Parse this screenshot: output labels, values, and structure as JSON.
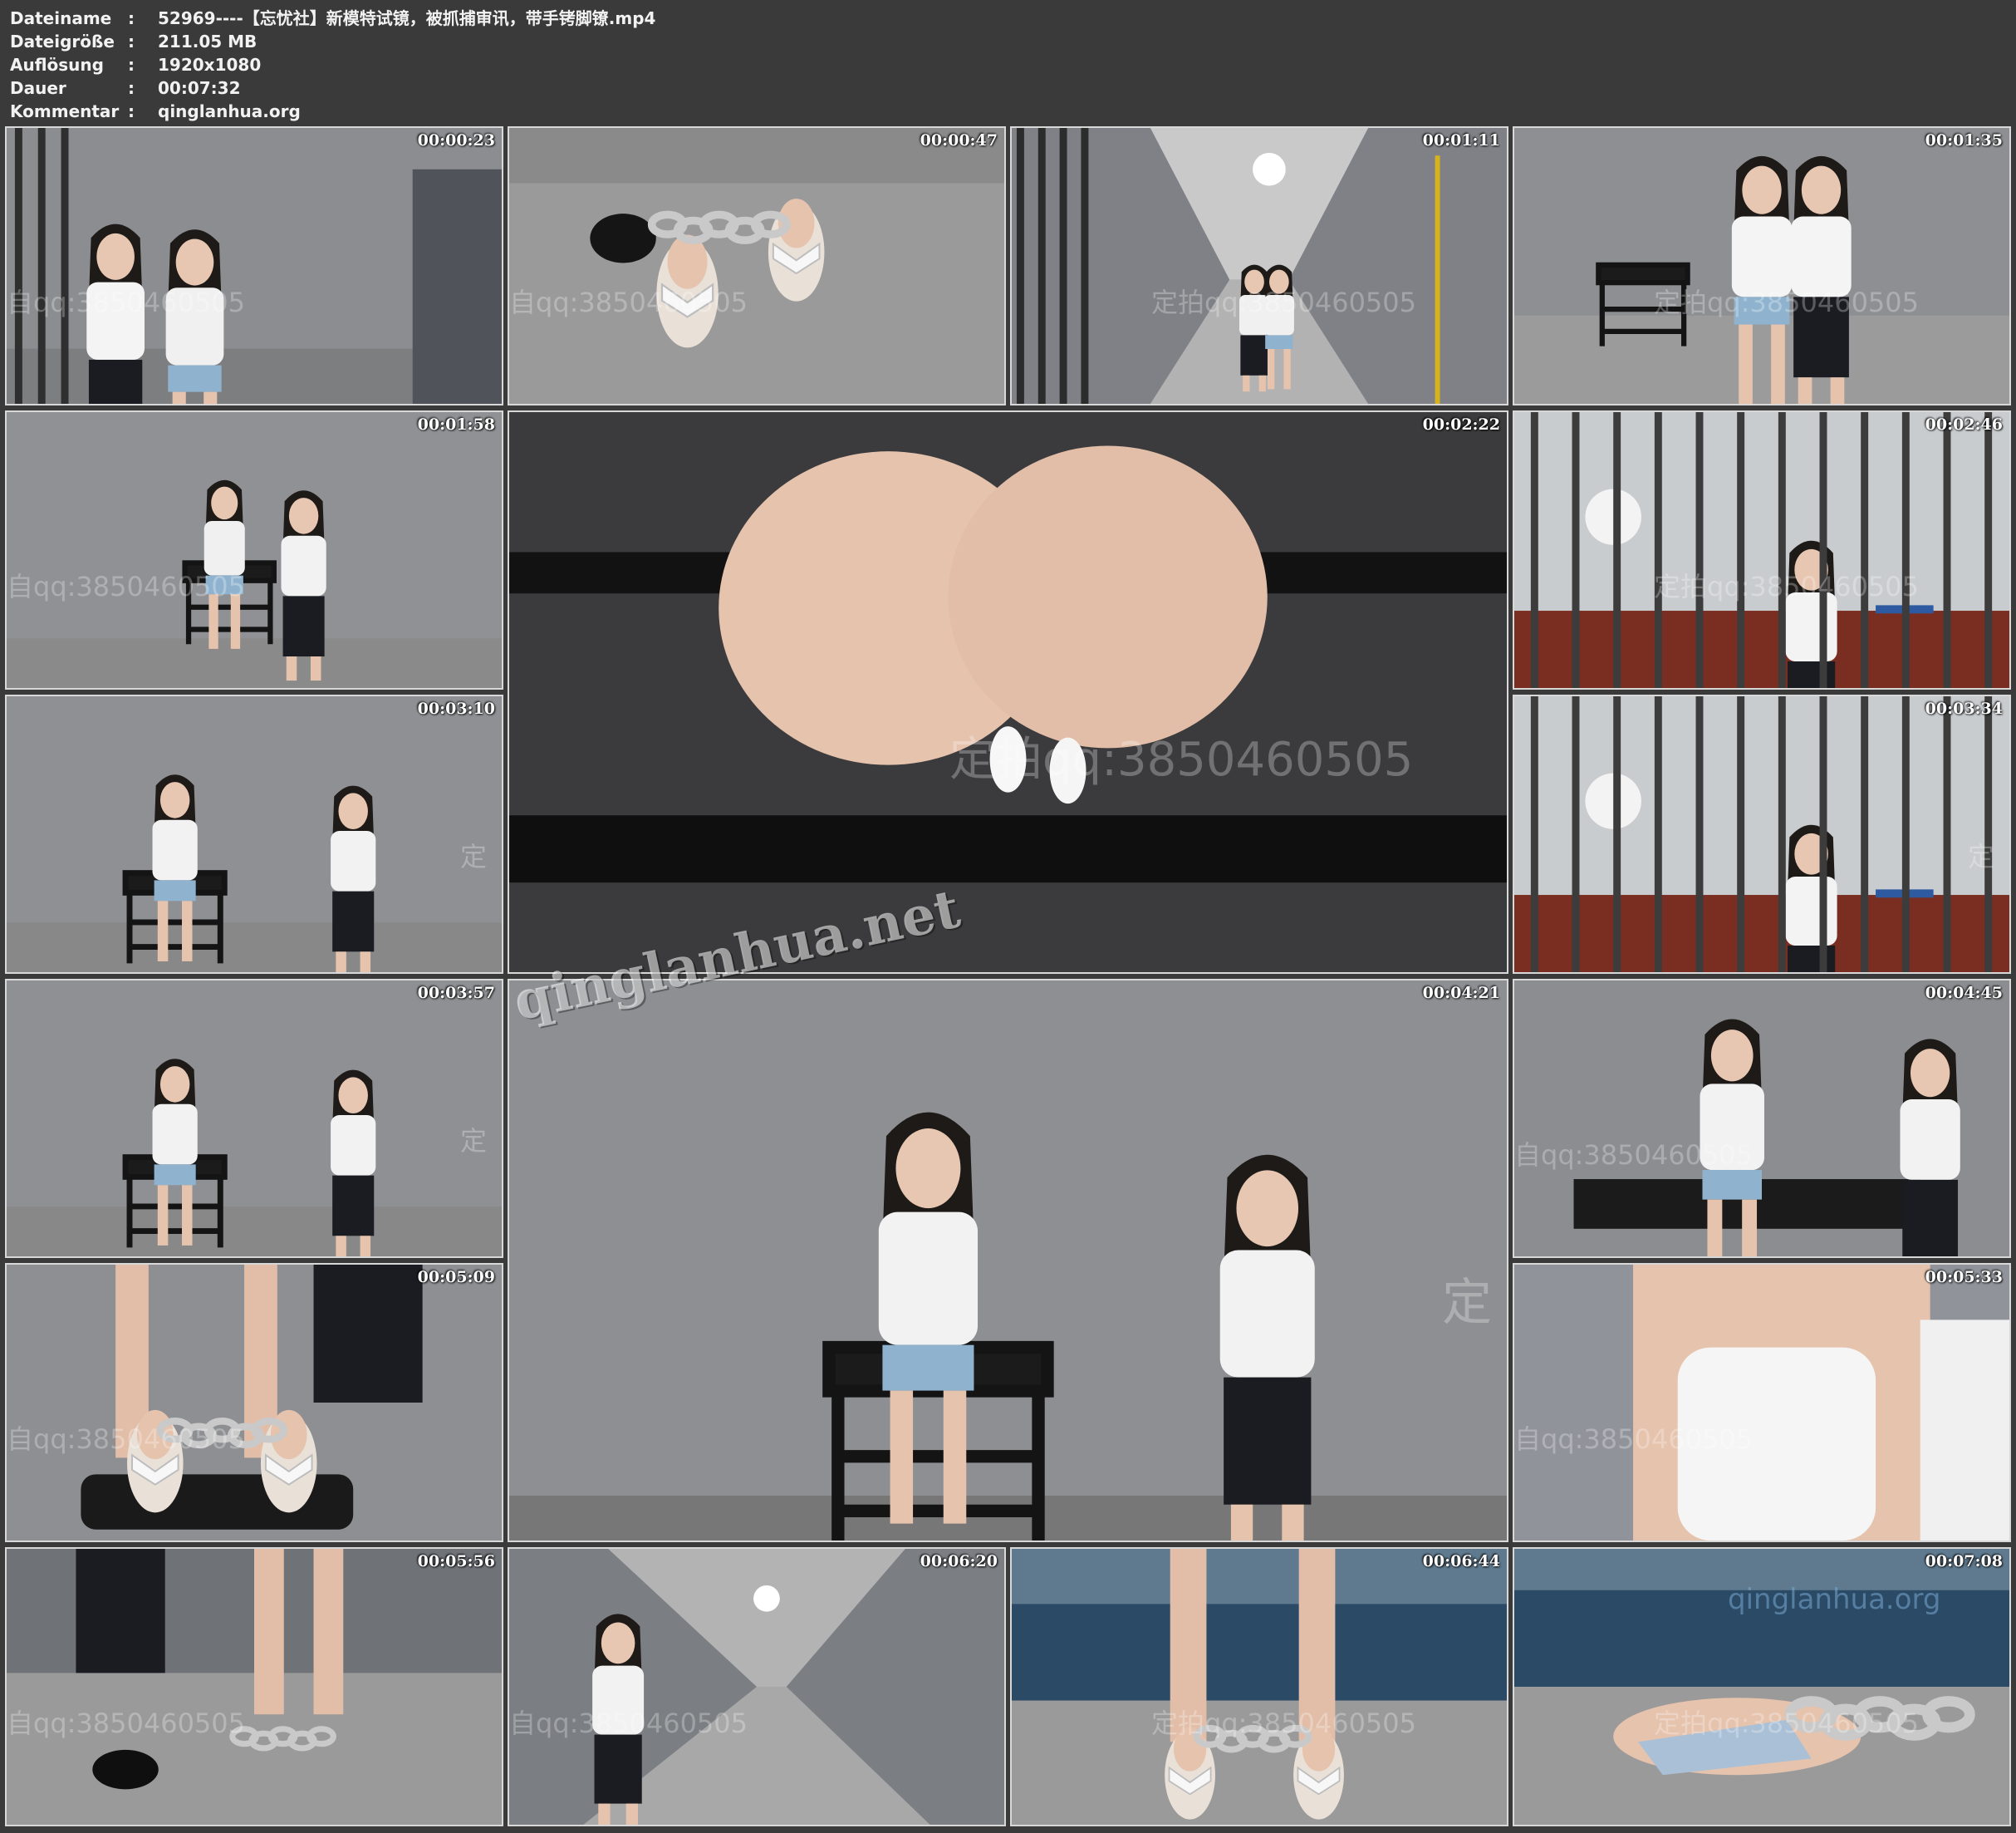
{
  "metadata": [
    {
      "label": "Dateiname",
      "value": "52969----【忘忧社】新模特试镜，被抓捕审讯，带手铐脚镣.mp4"
    },
    {
      "label": "Dateigröße",
      "value": "211.05 MB"
    },
    {
      "label": "Auflösung",
      "value": "1920x1080"
    },
    {
      "label": "Dauer",
      "value": "00:07:32"
    },
    {
      "label": "Kommentar",
      "value": "qinglanhua.org"
    }
  ],
  "separator": ":",
  "thumbnails": [
    {
      "timestamp": "00:00:23",
      "scene": "cell-door",
      "watermark": "自qq:3850460505"
    },
    {
      "timestamp": "00:00:47",
      "scene": "feet-chains",
      "watermark": "自qq:3850460505"
    },
    {
      "timestamp": "00:01:11",
      "scene": "corridor",
      "watermark": "定拍qq:3850460505"
    },
    {
      "timestamp": "00:01:35",
      "scene": "chair-room",
      "watermark": "定拍qq:3850460505"
    },
    {
      "timestamp": "00:01:58",
      "scene": "restraint-chair",
      "watermark": "自qq:3850460505"
    },
    {
      "timestamp": "00:02:22",
      "scene": "hands-closeup",
      "watermark": "定拍qq:3850460505"
    },
    {
      "timestamp": "00:02:46",
      "scene": "officer-desk",
      "watermark": "定拍qq:3850460505"
    },
    {
      "timestamp": "00:03:10",
      "scene": "seated-pair",
      "watermark": "定"
    },
    {
      "timestamp": "00:03:34",
      "scene": "officer-desk",
      "watermark": "定"
    },
    {
      "timestamp": "00:03:57",
      "scene": "seated-pair",
      "watermark": "定"
    },
    {
      "timestamp": "00:04:21",
      "scene": "seated-pair-large",
      "watermark": "定"
    },
    {
      "timestamp": "00:04:45",
      "scene": "seated-pair-close",
      "watermark": "自qq:3850460505"
    },
    {
      "timestamp": "00:05:09",
      "scene": "feet-chains-chair",
      "watermark": "自qq:3850460505"
    },
    {
      "timestamp": "00:05:33",
      "scene": "torso-closeup",
      "watermark": "自qq:3850460505"
    },
    {
      "timestamp": "00:05:56",
      "scene": "walking-feet",
      "watermark": "自qq:3850460505"
    },
    {
      "timestamp": "00:06:20",
      "scene": "long-corridor",
      "watermark": "自qq:3850460505"
    },
    {
      "timestamp": "00:06:44",
      "scene": "bed-feet",
      "watermark": "定拍qq:3850460505"
    },
    {
      "timestamp": "00:07:08",
      "scene": "bed-feet-close",
      "watermark": "定拍qq:3850460505"
    }
  ],
  "overlay_watermark": "qinglanhua.net",
  "corner_watermark": "qinglanhua.org"
}
